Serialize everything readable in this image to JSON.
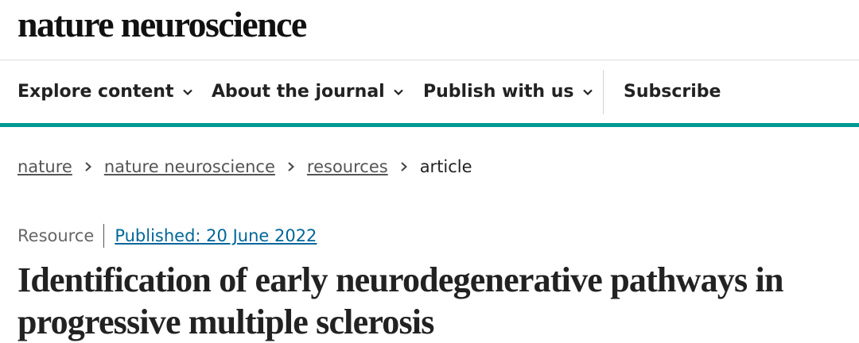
{
  "header": {
    "logo_text": "nature neuroscience"
  },
  "nav": {
    "items": [
      {
        "label": "Explore content"
      },
      {
        "label": "About the journal"
      },
      {
        "label": "Publish with us"
      }
    ],
    "subscribe_label": "Subscribe"
  },
  "breadcrumb": {
    "items": [
      "nature",
      "nature neuroscience",
      "resources"
    ],
    "current": "article"
  },
  "article": {
    "type": "Resource",
    "published": "Published: 20 June 2022",
    "title": "Identification of early neurodegenerative pathways in progressive multiple sclerosis"
  },
  "colors": {
    "accent": "#029894",
    "link": "#006699",
    "text": "#222222"
  },
  "icons": {
    "nav_dropdown": "chevron-down-icon",
    "breadcrumb_separator": "chevron-right-icon"
  }
}
